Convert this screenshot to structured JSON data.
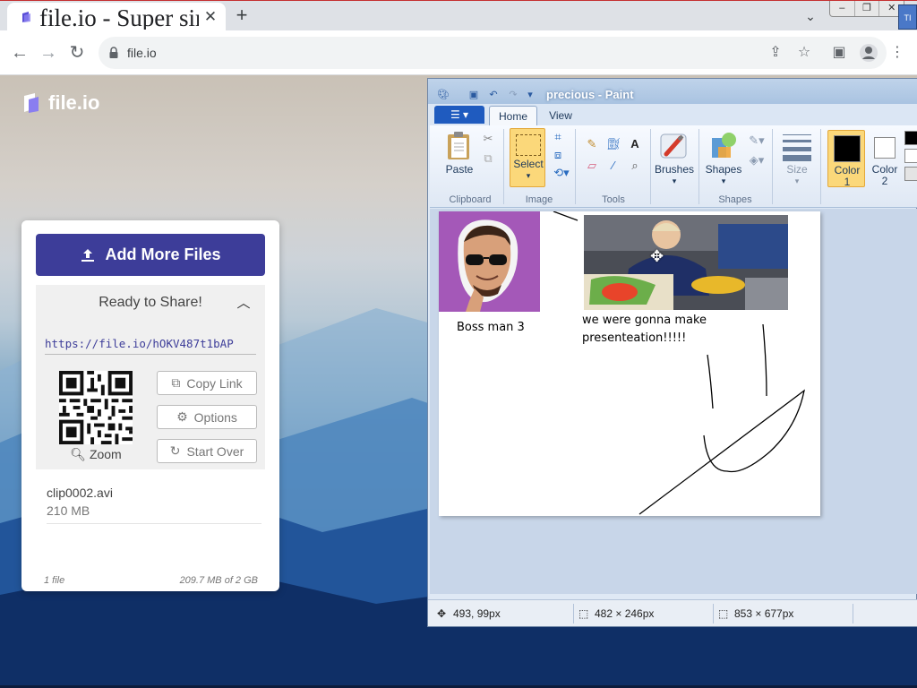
{
  "browser": {
    "tab_title": "file.io - Super simple file sharing",
    "new_tab_icon": "plus-icon",
    "url": "file.io",
    "window_controls": [
      "minimize",
      "restore",
      "close"
    ],
    "corner_badge": "TI"
  },
  "fileio": {
    "logo_text": "file.io",
    "add_button": "Add More Files",
    "panel_title": "Ready to Share!",
    "share_link": "https://file.io/hOKV487t1bAP",
    "zoom_label": "Zoom",
    "buttons": {
      "copy": "Copy Link",
      "options": "Options",
      "start_over": "Start Over"
    },
    "file": {
      "name": "clip0002.avi",
      "size": "210 MB"
    },
    "footer": {
      "count": "1 file",
      "usage": "209.7 MB of 2 GB"
    }
  },
  "paint": {
    "title": "precious - Paint",
    "tabs": {
      "home": "Home",
      "view": "View"
    },
    "groups": {
      "clipboard": "Clipboard",
      "image": "Image",
      "tools": "Tools",
      "shapes": "Shapes"
    },
    "labels": {
      "paste": "Paste",
      "select": "Select",
      "brushes": "Brushes",
      "shapes": "Shapes",
      "size": "Size",
      "color1": "Color",
      "color1_num": "1",
      "color2": "Color",
      "color2_num": "2"
    },
    "colors": {
      "color1": "#000000",
      "color2": "#ffffff"
    },
    "canvas_text": {
      "boss": "Boss man 3",
      "caption_line1": "we were gonna make",
      "caption_line2": "presenteation!!!!!"
    },
    "status": {
      "cursor": "493, 99px",
      "selection": "482 × 246px",
      "canvas_size": "853 × 677px"
    }
  }
}
